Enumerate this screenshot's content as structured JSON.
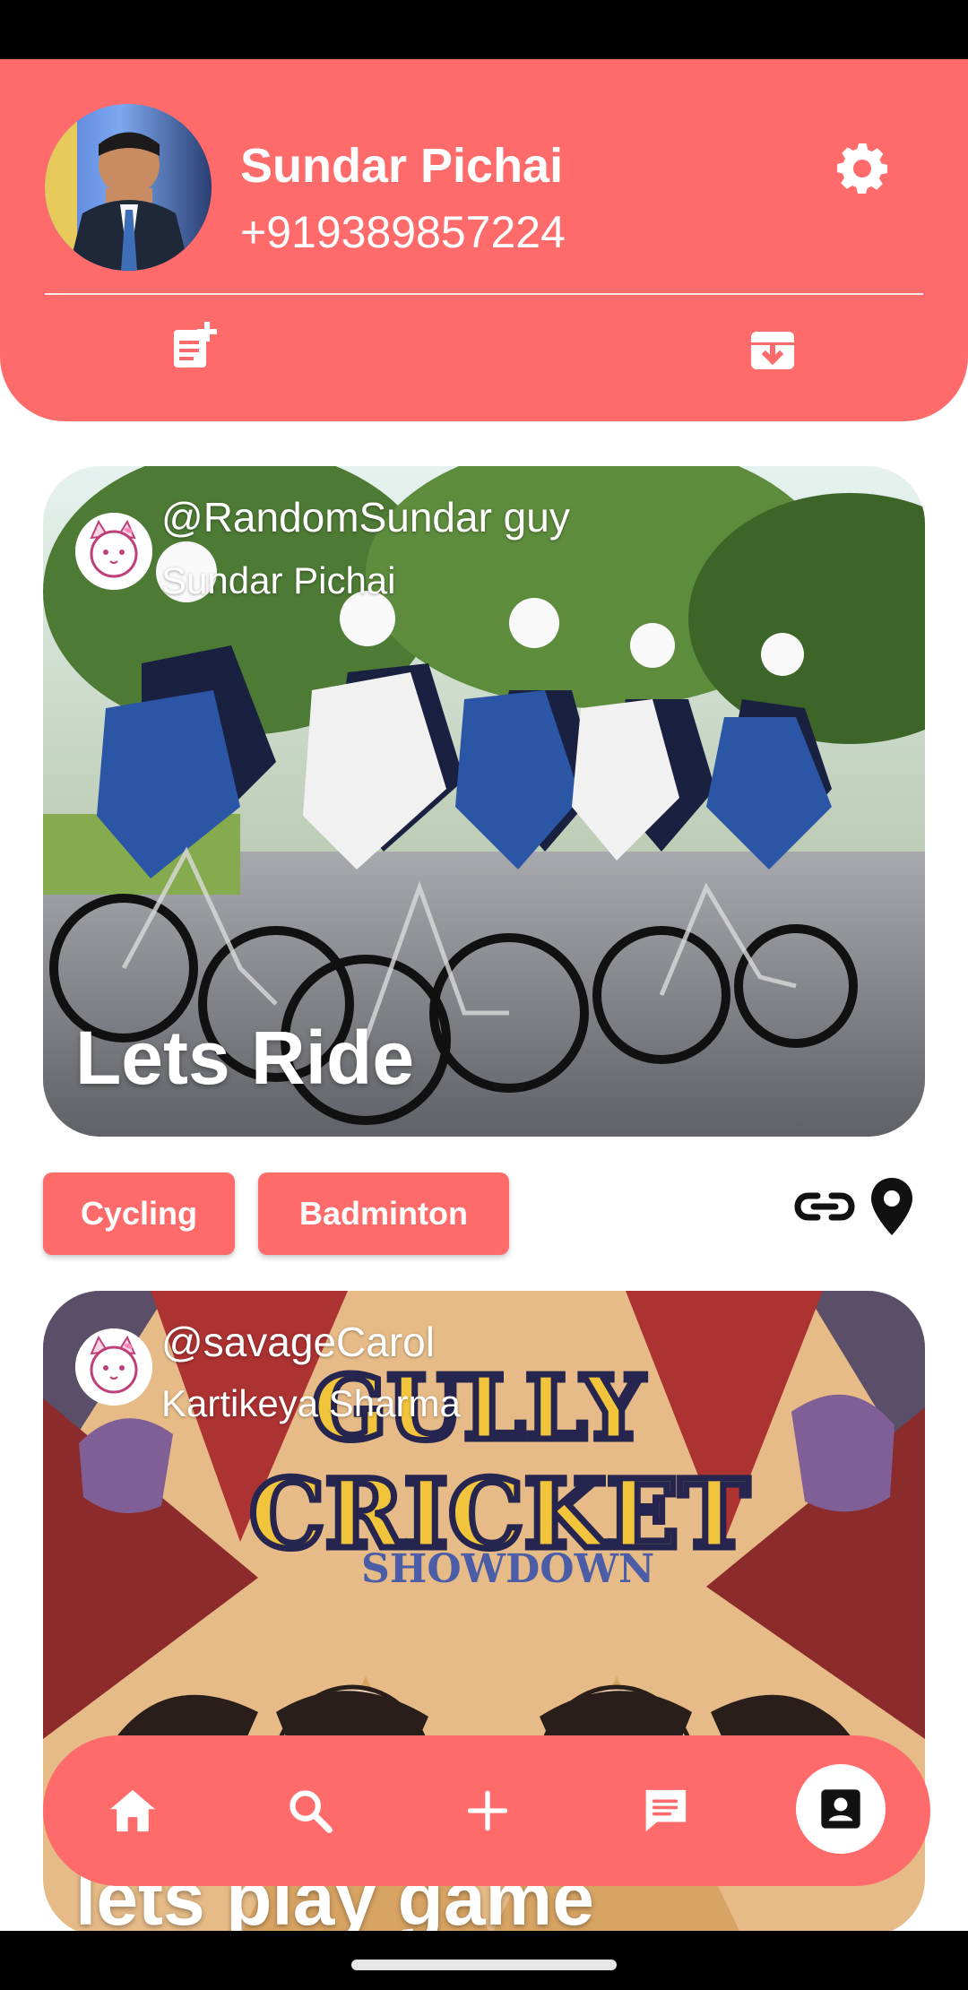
{
  "header": {
    "user_name": "Sundar Pichai",
    "phone": "+919389857224",
    "icons": {
      "settings": "gear-icon",
      "add_post": "add-post-icon",
      "archive": "archive-icon"
    }
  },
  "posts": [
    {
      "handle": "@RandomSundar guy",
      "author": "Sundar Pichai",
      "title": "Lets Ride",
      "tags": [
        "Cycling",
        "Badminton"
      ]
    },
    {
      "handle": "@savageCarol",
      "author": "Kartikeya Sharma",
      "title": "lets play game",
      "poster_text": {
        "line1": "GULLY",
        "line2": "CRICKET",
        "line3": "SHOWDOWN"
      }
    }
  ],
  "actions": {
    "link_icon": "link-icon",
    "location_icon": "location-pin-icon"
  },
  "bottom_nav": {
    "items": [
      {
        "name": "home",
        "icon": "home-icon"
      },
      {
        "name": "search",
        "icon": "search-icon"
      },
      {
        "name": "add",
        "icon": "plus-icon"
      },
      {
        "name": "messages",
        "icon": "chat-icon"
      },
      {
        "name": "profile",
        "icon": "contact-icon"
      }
    ]
  },
  "colors": {
    "accent": "#ff6b6b",
    "white": "#ffffff",
    "black": "#000000"
  }
}
